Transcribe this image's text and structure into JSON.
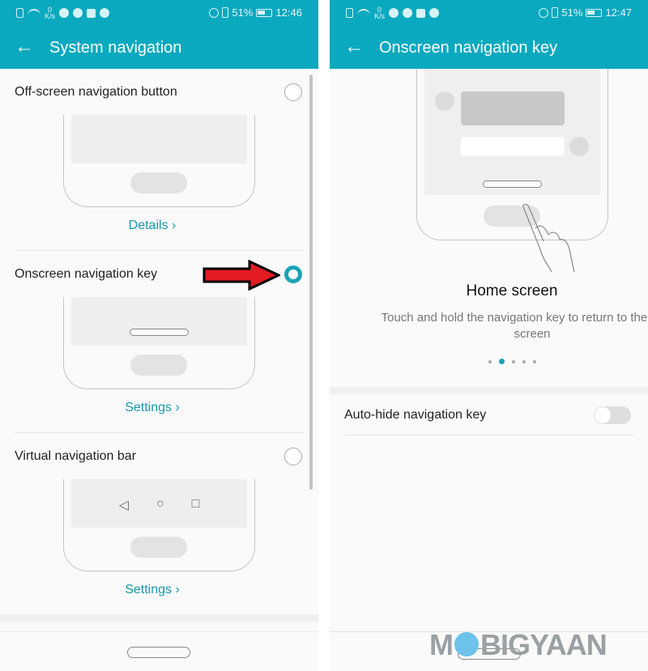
{
  "left": {
    "status": {
      "netspeed_value": "0",
      "netspeed_unit": "K/s",
      "battery": "51%",
      "time": "12:46"
    },
    "appbar": {
      "back_icon": "←",
      "title": "System navigation"
    },
    "options": [
      {
        "label": "Off-screen navigation button",
        "selected": false,
        "link": "Details",
        "preview": "pill-only"
      },
      {
        "label": "Onscreen navigation key",
        "selected": true,
        "link": "Settings",
        "preview": "onscreen-key"
      },
      {
        "label": "Virtual navigation bar",
        "selected": false,
        "link": "Settings",
        "preview": "three-button-bar"
      }
    ],
    "chevron": "›",
    "navbar_glyphs": {
      "back": "◁",
      "home": "○",
      "recents": "□"
    }
  },
  "right": {
    "status": {
      "netspeed_value": "0",
      "netspeed_unit": "K/s",
      "battery": "51%",
      "time": "12:47"
    },
    "appbar": {
      "back_icon": "←",
      "title": "Onscreen navigation key"
    },
    "tutorial": {
      "title": "Home screen",
      "description": "Touch and hold the navigation key to return to the Home screen",
      "page_count": 5,
      "active_page": 2
    },
    "settings": [
      {
        "label": "Auto-hide navigation key",
        "enabled": false
      }
    ]
  },
  "annotation": {
    "arrow_color": "#e31b23"
  },
  "colors": {
    "accent": "#0aa9bf",
    "link": "#1a97aa",
    "radio_selected": "#1aa2b5"
  },
  "watermark": {
    "prefix": "M",
    "suffix": "BIGYAAN"
  }
}
